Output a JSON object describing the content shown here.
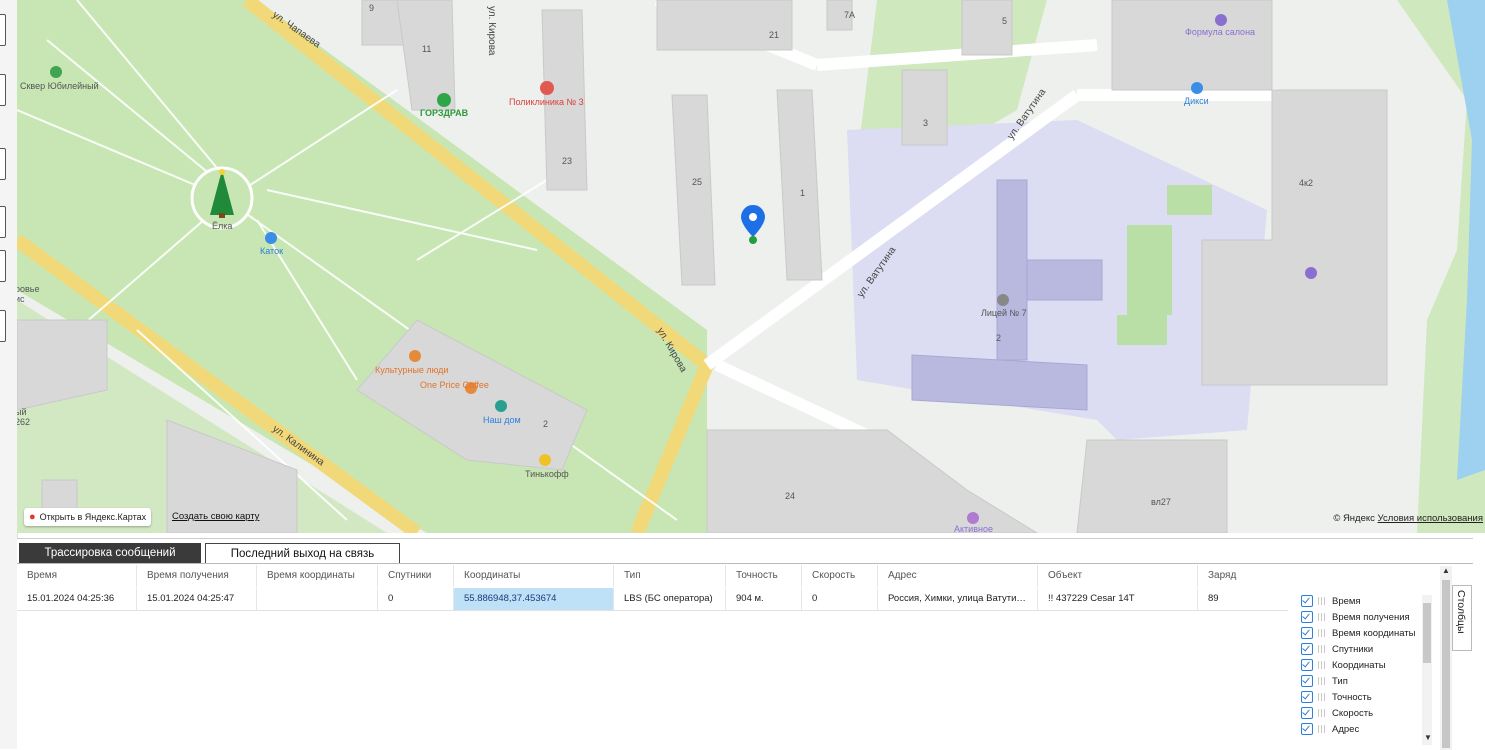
{
  "map": {
    "streets": [
      "ул. Чапаева",
      "ул. Кирова",
      "ул. Кирова",
      "ул. Калинина",
      "ул. Ватутина",
      "ул. Ватутина"
    ],
    "places": [
      "Сквер Юбилейный",
      "Ёлка",
      "Каток",
      "ГОРЗДРАВ",
      "Поликлиника № 3",
      "Культурные люди",
      "One Price Coffee",
      "Наш дом",
      "Тинькофф",
      "Формула салона",
      "Дикси",
      "Лицей № 7",
      "Активное"
    ],
    "house_numbers": [
      "9",
      "11",
      "7А",
      "21",
      "5",
      "23",
      "25",
      "1",
      "3",
      "4к2",
      "2",
      "2",
      "24",
      "вл27"
    ],
    "edge_labels": [
      "Сквер Юбилейный",
      "ровье",
      "ис",
      "ый",
      "262"
    ],
    "open_in_yandex": "Открыть в Яндекс.Картах",
    "create_map": "Создать свою карту",
    "copyright": "© Яндекс",
    "terms": "Условия использования"
  },
  "tabs": {
    "trace": "Трассировка сообщений",
    "last_seen": "Последний выход на связь"
  },
  "table": {
    "columns": [
      "Время",
      "Время получения",
      "Время координаты",
      "Спутники",
      "Координаты",
      "Тип",
      "Точность",
      "Скорость",
      "Адрес",
      "Объект",
      "Заряд"
    ],
    "rows": [
      [
        "15.01.2024 04:25:36",
        "15.01.2024 04:25:47",
        "",
        "0",
        "55.886948,37.453674",
        "LBS (БС оператора)",
        "904 м.",
        "0",
        "Россия, Химки, улица Ватутин…",
        "!! 437229 Cesar 14T",
        "89"
      ]
    ]
  },
  "column_picker": {
    "items": [
      "Время",
      "Время получения",
      "Время координаты",
      "Спутники",
      "Координаты",
      "Тип",
      "Точность",
      "Скорость",
      "Адрес"
    ]
  },
  "side_tab": "Столбцы",
  "colors": {
    "park": "#c8e6b4",
    "road_yellow": "#f7e79a",
    "school": "#d9daf2",
    "selected_cell": "#bfe1f7",
    "marker": "#1e6fe6"
  }
}
